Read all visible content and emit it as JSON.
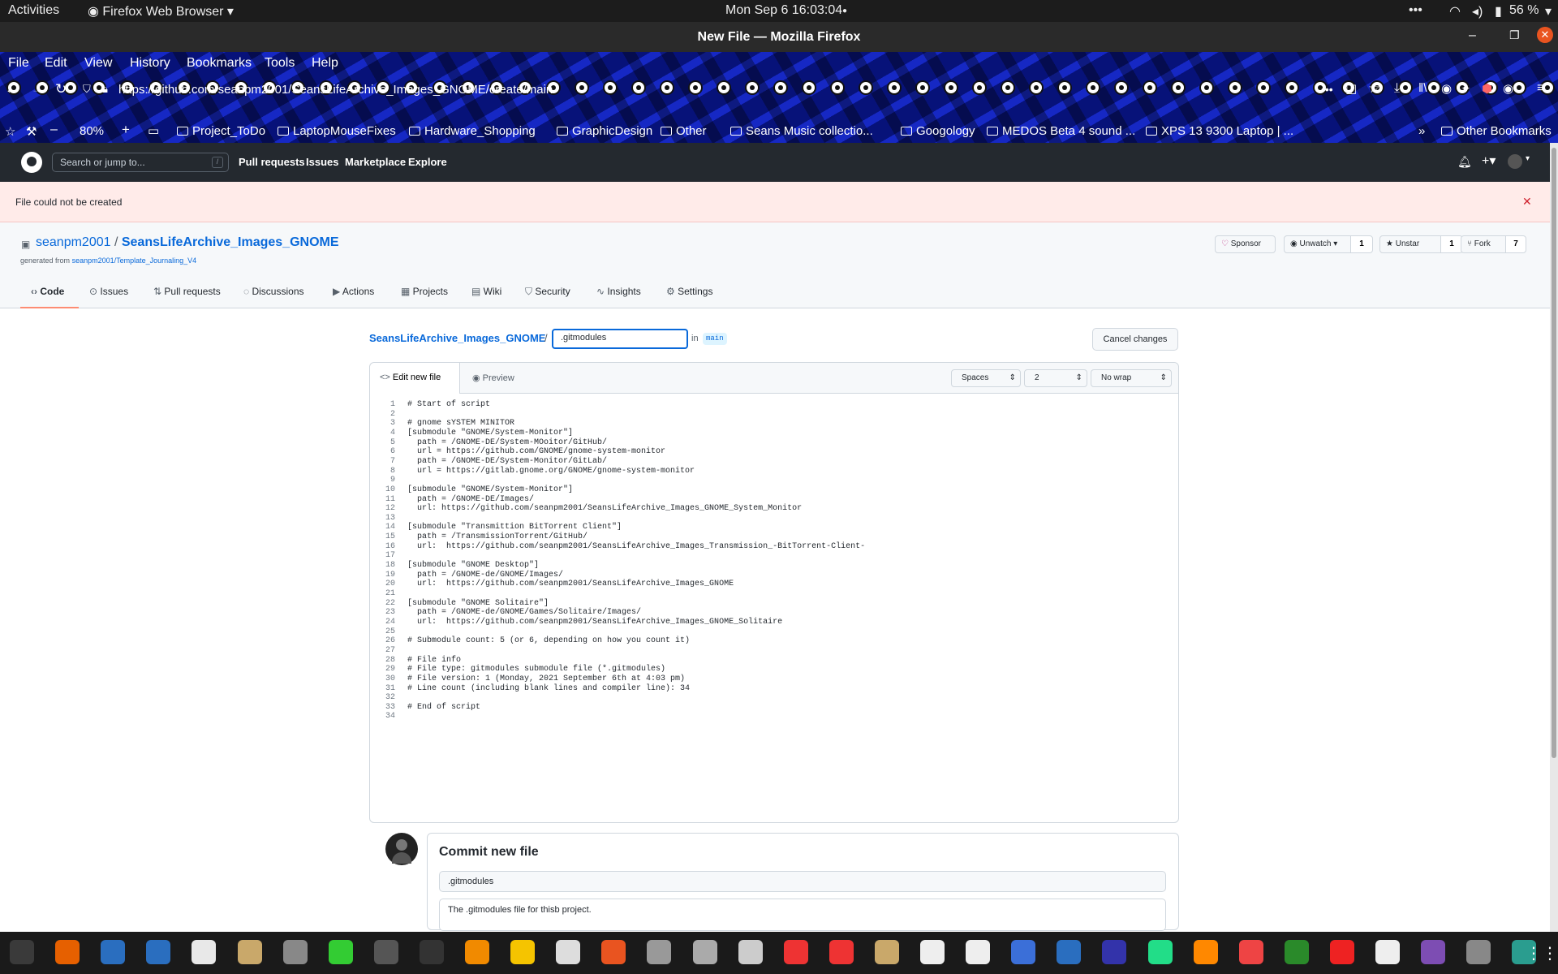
{
  "system": {
    "activities": "Activities",
    "app_menu": "Firefox Web Browser",
    "clock": "Mon Sep 6  16:03:04",
    "battery": "56 %"
  },
  "window": {
    "title": "New File — Mozilla Firefox"
  },
  "menubar": [
    "File",
    "Edit",
    "View",
    "History",
    "Bookmarks",
    "Tools",
    "Help"
  ],
  "urlbar": {
    "url": "https://github.com/seanpm2001/SeansLifeArchive_Images_GNOME/create/main",
    "zoom": "80%"
  },
  "bookmarks": [
    "Project_ToDo",
    "LaptopMouseFixes",
    "Hardware_Shopping",
    "GraphicDesign",
    "Other",
    "Seans Music collectio...",
    "Googology",
    "MEDOS Beta 4 sound ...",
    "XPS 13 9300 Laptop | ...",
    "Other Bookmarks"
  ],
  "github": {
    "search_placeholder": "Search or jump to...",
    "search_key": "/",
    "nav": [
      "Pull requests",
      "Issues",
      "Marketplace",
      "Explore"
    ],
    "flash": "File could not be created",
    "owner": "seanpm2001",
    "repo": "SeansLifeArchive_Images_GNOME",
    "generated_prefix": "generated from",
    "generated_link": "seanpm2001/Template_Journaling_V4",
    "sponsor": "Sponsor",
    "unwatch": "Unwatch",
    "unwatch_count": "1",
    "unstar": "Unstar",
    "star_count": "1",
    "fork": "Fork",
    "fork_count": "7",
    "tabs": [
      "Code",
      "Issues",
      "Pull requests",
      "Discussions",
      "Actions",
      "Projects",
      "Wiki",
      "Security",
      "Insights",
      "Settings"
    ],
    "breadcrumb_repo": "SeansLifeArchive_Images_GNOME",
    "filename": ".gitmodules",
    "in_label": "in",
    "branch": "main",
    "cancel": "Cancel changes",
    "edit_tab": "Edit new file",
    "preview_tab": "Preview",
    "indent_mode": "Spaces",
    "indent_size": "2",
    "wrap_mode": "No wrap",
    "code_lines": [
      "# Start of script",
      "",
      "# gnome sYSTEM MINITOR",
      "[submodule \"GNOME/System-Monitor\"]",
      "  path = /GNOME-DE/System-MOoitor/GitHub/",
      "  url = https://github.com/GNOME/gnome-system-monitor",
      "  path = /GNOME-DE/System-Monitor/GitLab/",
      "  url = https://gitlab.gnome.org/GNOME/gnome-system-monitor",
      "",
      "[submodule \"GNOME/System-Monitor\"]",
      "  path = /GNOME-DE/Images/",
      "  url: https://github.com/seanpm2001/SeansLifeArchive_Images_GNOME_System_Monitor",
      "",
      "[submodule \"Transmittion BitTorrent Client\"]",
      "  path = /TransmissionTorrent/GitHub/",
      "  url:  https://github.com/seanpm2001/SeansLifeArchive_Images_Transmission_-BitTorrent-Client-",
      "",
      "[submodule \"GNOME Desktop\"]",
      "  path = /GNOME-de/GNOME/Images/",
      "  url:  https://github.com/seanpm2001/SeansLifeArchive_Images_GNOME",
      "",
      "[submodule \"GNOME Solitaire\"]",
      "  path = /GNOME-de/GNOME/Games/Solitaire/Images/",
      "  url:  https://github.com/seanpm2001/SeansLifeArchive_Images_GNOME_Solitaire",
      "",
      "# Submodule count: 5 (or 6, depending on how you count it)",
      "",
      "# File info",
      "# File type: gitmodules submodule file (*.gitmodules)",
      "# File version: 1 (Monday, 2021 September 6th at 4:03 pm)",
      "# Line count (including blank lines and compiler line): 34",
      "",
      "# End of script",
      ""
    ],
    "commit_title": "Commit new file",
    "commit_summary": ".gitmodules",
    "commit_description": "The .gitmodules file for thisb project."
  }
}
